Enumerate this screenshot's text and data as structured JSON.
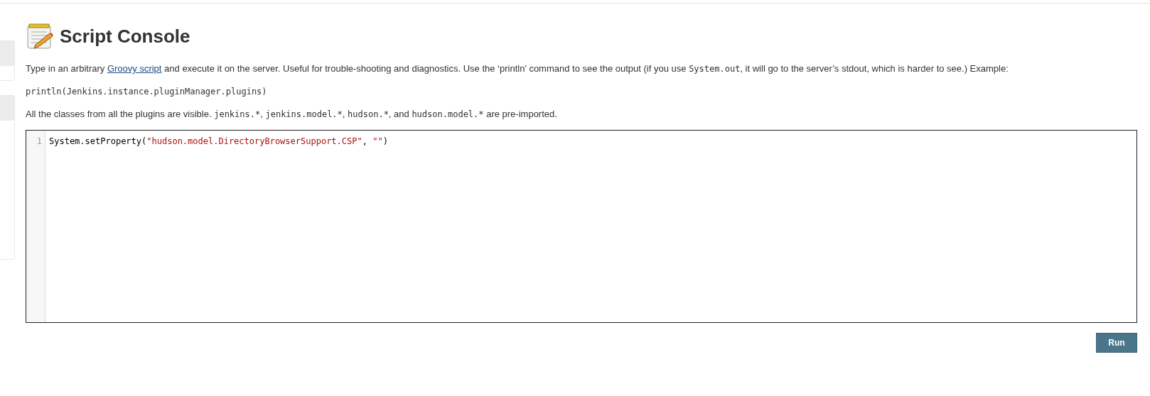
{
  "title": "Script Console",
  "intro": [
    {
      "kind": "text",
      "text": "Type in an arbitrary "
    },
    {
      "kind": "link",
      "text": "Groovy script"
    },
    {
      "kind": "text",
      "text": " and execute it on the server. Useful for trouble-shooting and diagnostics. Use the ‘println’ command to see the output (if you use "
    },
    {
      "kind": "code",
      "text": "System.out"
    },
    {
      "kind": "text",
      "text": ", it will go to the server’s stdout, which is harder to see.) Example:"
    }
  ],
  "example": "println(Jenkins.instance.pluginManager.plugins)",
  "imports": [
    {
      "kind": "text",
      "text": "All the classes from all the plugins are visible. "
    },
    {
      "kind": "code",
      "text": "jenkins.*"
    },
    {
      "kind": "text",
      "text": ", "
    },
    {
      "kind": "code",
      "text": "jenkins.model.*"
    },
    {
      "kind": "text",
      "text": ", "
    },
    {
      "kind": "code",
      "text": "hudson.*"
    },
    {
      "kind": "text",
      "text": ", and "
    },
    {
      "kind": "code",
      "text": "hudson.model.*"
    },
    {
      "kind": "text",
      "text": " are pre-imported."
    }
  ],
  "editor": {
    "lines": [
      {
        "number": "1",
        "tokens": [
          {
            "kind": "plain",
            "text": "System.setProperty("
          },
          {
            "kind": "string",
            "text": "\"hudson.model.DirectoryBrowserSupport.CSP\""
          },
          {
            "kind": "plain",
            "text": ", "
          },
          {
            "kind": "string",
            "text": "\"\""
          },
          {
            "kind": "plain",
            "text": ")"
          }
        ]
      }
    ]
  },
  "run_button": "Run"
}
